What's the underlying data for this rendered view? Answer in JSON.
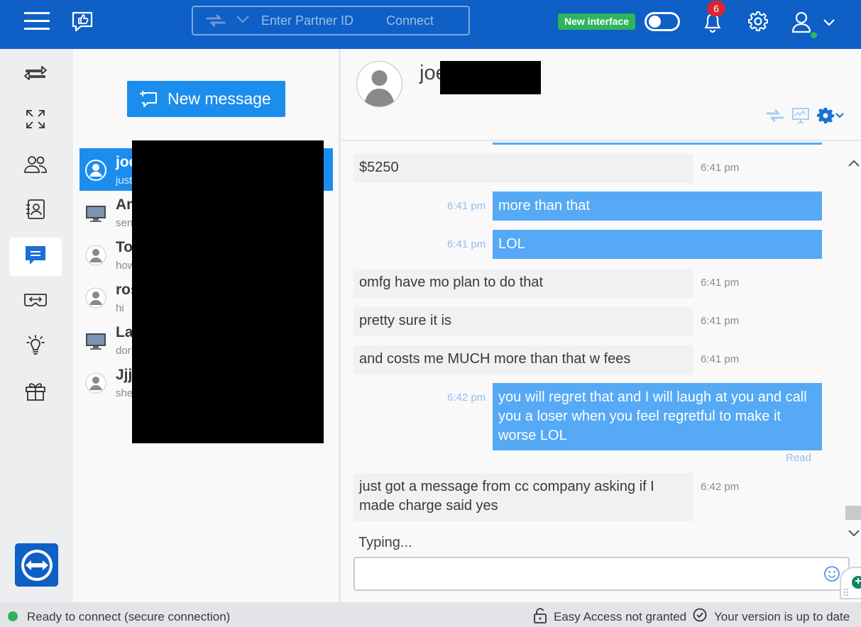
{
  "topbar": {
    "partner_placeholder": "Enter Partner ID",
    "connect_label": "Connect",
    "new_interface_label": "New interface",
    "notification_count": "6",
    "toggle_on": false,
    "accent_color": "#0e5fc6"
  },
  "sidebar": {
    "items": [
      {
        "name": "remote-control-icon"
      },
      {
        "name": "remote-management-icon"
      },
      {
        "name": "meeting-icon"
      },
      {
        "name": "contacts-icon"
      },
      {
        "name": "chat-icon",
        "active": true
      },
      {
        "name": "augmented-reality-icon"
      },
      {
        "name": "getting-started-icon"
      },
      {
        "name": "whats-new-icon"
      }
    ]
  },
  "conversations": {
    "new_message_label": "New message",
    "items": [
      {
        "name": "joe",
        "preview": "just",
        "type": "user",
        "selected": true
      },
      {
        "name": "An",
        "preview": "sen",
        "type": "computer"
      },
      {
        "name": "To",
        "preview": "how",
        "type": "user"
      },
      {
        "name": "ros",
        "preview": "hi",
        "type": "user"
      },
      {
        "name": "La",
        "preview": "dor",
        "type": "computer"
      },
      {
        "name": "Jjjj",
        "preview": "she",
        "type": "user"
      }
    ]
  },
  "chat": {
    "contact_name": "joe",
    "messages": [
      {
        "dir": "in",
        "text": "$5250",
        "time": "6:41 pm"
      },
      {
        "dir": "out",
        "text": "more than that",
        "time": "6:41 pm"
      },
      {
        "dir": "out",
        "text": "LOL",
        "time": "6:41 pm"
      },
      {
        "dir": "in",
        "text": "omfg   have mo plan to do that",
        "time": "6:41 pm"
      },
      {
        "dir": "in",
        "text": "pretty sure it is",
        "time": "6:41 pm"
      },
      {
        "dir": "in",
        "text": "and costs me MUCH more than that w fees",
        "time": "6:41 pm"
      },
      {
        "dir": "out",
        "text": "you will regret that and I will laugh at you and call you a loser when you feel regretful to make it worse LOL",
        "time": "6:42 pm",
        "status": "Read"
      },
      {
        "dir": "in",
        "text": "just got a message from cc company asking if I made charge    said yes",
        "time": "6:42 pm"
      }
    ],
    "typing_label": "Typing...",
    "input_value": ""
  },
  "status": {
    "connection": "Ready to connect (secure connection)",
    "easy_access": "Easy Access not granted",
    "version": "Your version is up to date"
  }
}
